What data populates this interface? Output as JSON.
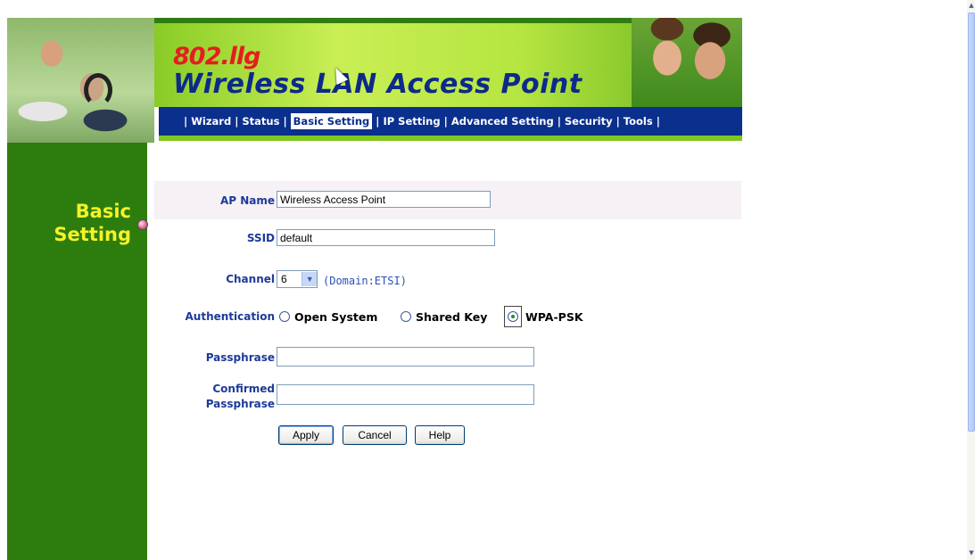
{
  "header": {
    "subtitle": "802.llg",
    "title": "Wireless LAN Access Point",
    "nav": [
      {
        "label": "Wizard",
        "active": false
      },
      {
        "label": "Status",
        "active": false
      },
      {
        "label": "Basic Setting",
        "active": true
      },
      {
        "label": "IP Setting",
        "active": false
      },
      {
        "label": "Advanced Setting",
        "active": false
      },
      {
        "label": "Security",
        "active": false
      },
      {
        "label": "Tools",
        "active": false
      }
    ],
    "separator": "|"
  },
  "sidebar": {
    "title_line1": "Basic",
    "title_line2": "Setting"
  },
  "form": {
    "ap_name_label": "AP Name",
    "ap_name_value": "Wireless Access Point",
    "ssid_label": "SSID",
    "ssid_value": "default",
    "channel_label": "Channel",
    "channel_value": "6",
    "domain_text": "(Domain:ETSI)",
    "auth_label": "Authentication",
    "auth_options": [
      {
        "label": "Open System",
        "selected": false
      },
      {
        "label": "Shared Key",
        "selected": false
      },
      {
        "label": "WPA-PSK",
        "selected": true
      }
    ],
    "passphrase_label": "Passphrase",
    "passphrase_value": "",
    "confirmed_label_line1": "Confirmed",
    "confirmed_label_line2": "Passphrase",
    "confirmed_value": ""
  },
  "buttons": {
    "apply": "Apply",
    "cancel": "Cancel",
    "help": "Help"
  },
  "colors": {
    "nav_bg": "#0b2f8c",
    "sidebar_bg": "#2d7d0e",
    "sidebar_text": "#f3f32a",
    "label_text": "#1d3a9a"
  },
  "icons": {
    "cursor": "mouse-pointer-icon",
    "sidebar_marker": "pink-dot-icon",
    "select_arrow": "chevron-down-icon"
  }
}
